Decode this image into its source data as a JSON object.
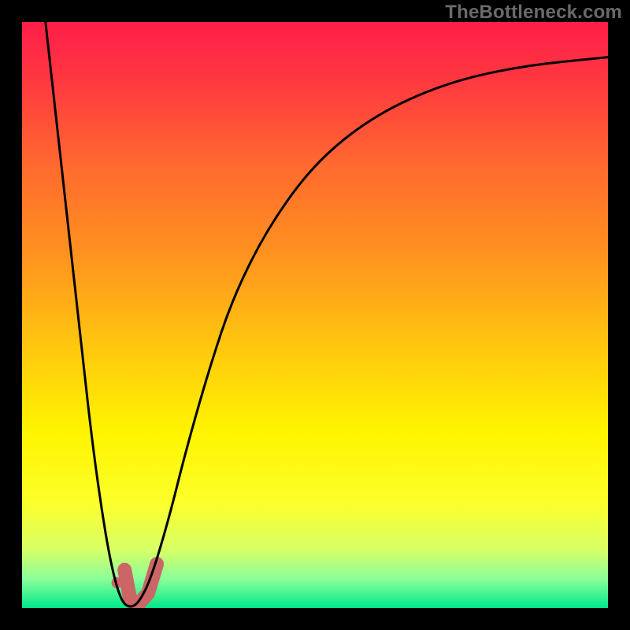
{
  "watermark": "TheBottleneck.com",
  "chart_data": {
    "type": "line",
    "title": "",
    "xlabel": "",
    "ylabel": "",
    "xlim": [
      0,
      100
    ],
    "ylim": [
      0,
      100
    ],
    "axes_visible": false,
    "grid": false,
    "background_gradient": {
      "stops": [
        {
          "offset": 0.0,
          "color": "#ff1e49"
        },
        {
          "offset": 0.1,
          "color": "#ff3840"
        },
        {
          "offset": 0.25,
          "color": "#ff6b2e"
        },
        {
          "offset": 0.4,
          "color": "#ff931f"
        },
        {
          "offset": 0.55,
          "color": "#ffc60f"
        },
        {
          "offset": 0.7,
          "color": "#fff400"
        },
        {
          "offset": 0.82,
          "color": "#fcff2a"
        },
        {
          "offset": 0.9,
          "color": "#d8ff66"
        },
        {
          "offset": 0.95,
          "color": "#8cff9a"
        },
        {
          "offset": 1.0,
          "color": "#00e88a"
        }
      ]
    },
    "series": [
      {
        "name": "bottleneck-curve",
        "stroke": "#000000",
        "stroke_width": 3,
        "points": [
          {
            "x": 4.0,
            "y": 100.0
          },
          {
            "x": 6.0,
            "y": 82.0
          },
          {
            "x": 8.0,
            "y": 64.0
          },
          {
            "x": 10.0,
            "y": 46.0
          },
          {
            "x": 12.0,
            "y": 28.0
          },
          {
            "x": 14.0,
            "y": 14.0
          },
          {
            "x": 15.5,
            "y": 6.0
          },
          {
            "x": 17.0,
            "y": 1.0
          },
          {
            "x": 18.5,
            "y": 0.0
          },
          {
            "x": 20.0,
            "y": 1.0
          },
          {
            "x": 22.0,
            "y": 5.0
          },
          {
            "x": 25.0,
            "y": 15.0
          },
          {
            "x": 28.0,
            "y": 27.0
          },
          {
            "x": 32.0,
            "y": 41.0
          },
          {
            "x": 36.0,
            "y": 53.0
          },
          {
            "x": 42.0,
            "y": 65.0
          },
          {
            "x": 50.0,
            "y": 76.0
          },
          {
            "x": 60.0,
            "y": 84.0
          },
          {
            "x": 72.0,
            "y": 89.5
          },
          {
            "x": 85.0,
            "y": 92.5
          },
          {
            "x": 100.0,
            "y": 94.0
          }
        ]
      }
    ],
    "markers": [
      {
        "name": "selection-hook",
        "color": "#cc6666",
        "stroke_width": 18,
        "linecap": "round",
        "points": [
          {
            "x": 17.5,
            "y": 6.5
          },
          {
            "x": 18.5,
            "y": 1.2
          },
          {
            "x": 20.0,
            "y": 0.8
          },
          {
            "x": 21.5,
            "y": 2.5
          },
          {
            "x": 23.0,
            "y": 7.5
          }
        ]
      },
      {
        "name": "selection-dot",
        "color": "#cc6666",
        "type": "dot",
        "radius": 7,
        "point": {
          "x": 16.2,
          "y": 4.3
        }
      }
    ]
  }
}
